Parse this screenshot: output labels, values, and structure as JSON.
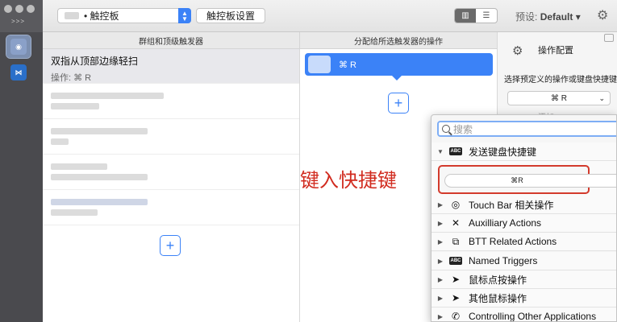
{
  "toolbar": {
    "device": "• 触控板",
    "settings_button": "触控板设置",
    "preset_label": "预设:",
    "preset_value": "Default ▾"
  },
  "columns": {
    "triggers_header": "群组和顶级触发器",
    "actions_header": "分配给所选触发器的操作"
  },
  "selected_trigger": {
    "title": "双指从顶部边缘轻扫",
    "subtitle": "操作: ⌘ R"
  },
  "assigned_action": {
    "label": "⌘ R"
  },
  "config": {
    "title": "操作配置",
    "label": "选择预定义的操作或键盘快捷键",
    "select_value": "⌘ R",
    "hint": "添加..."
  },
  "annotation": "键入快捷键",
  "popup": {
    "search_placeholder": "搜索",
    "expanded_category": "发送键盘快捷键",
    "shortcut_value": "⌘R",
    "categories": [
      "Touch Bar 相关操作",
      "Auxilliary Actions",
      "BTT Related Actions",
      "Named Triggers",
      "鼠标点按操作",
      "其他鼠标操作",
      "Controlling Other Applications"
    ]
  },
  "colors": {
    "accent": "#3b82f7",
    "highlight_red": "#d33a2c"
  }
}
